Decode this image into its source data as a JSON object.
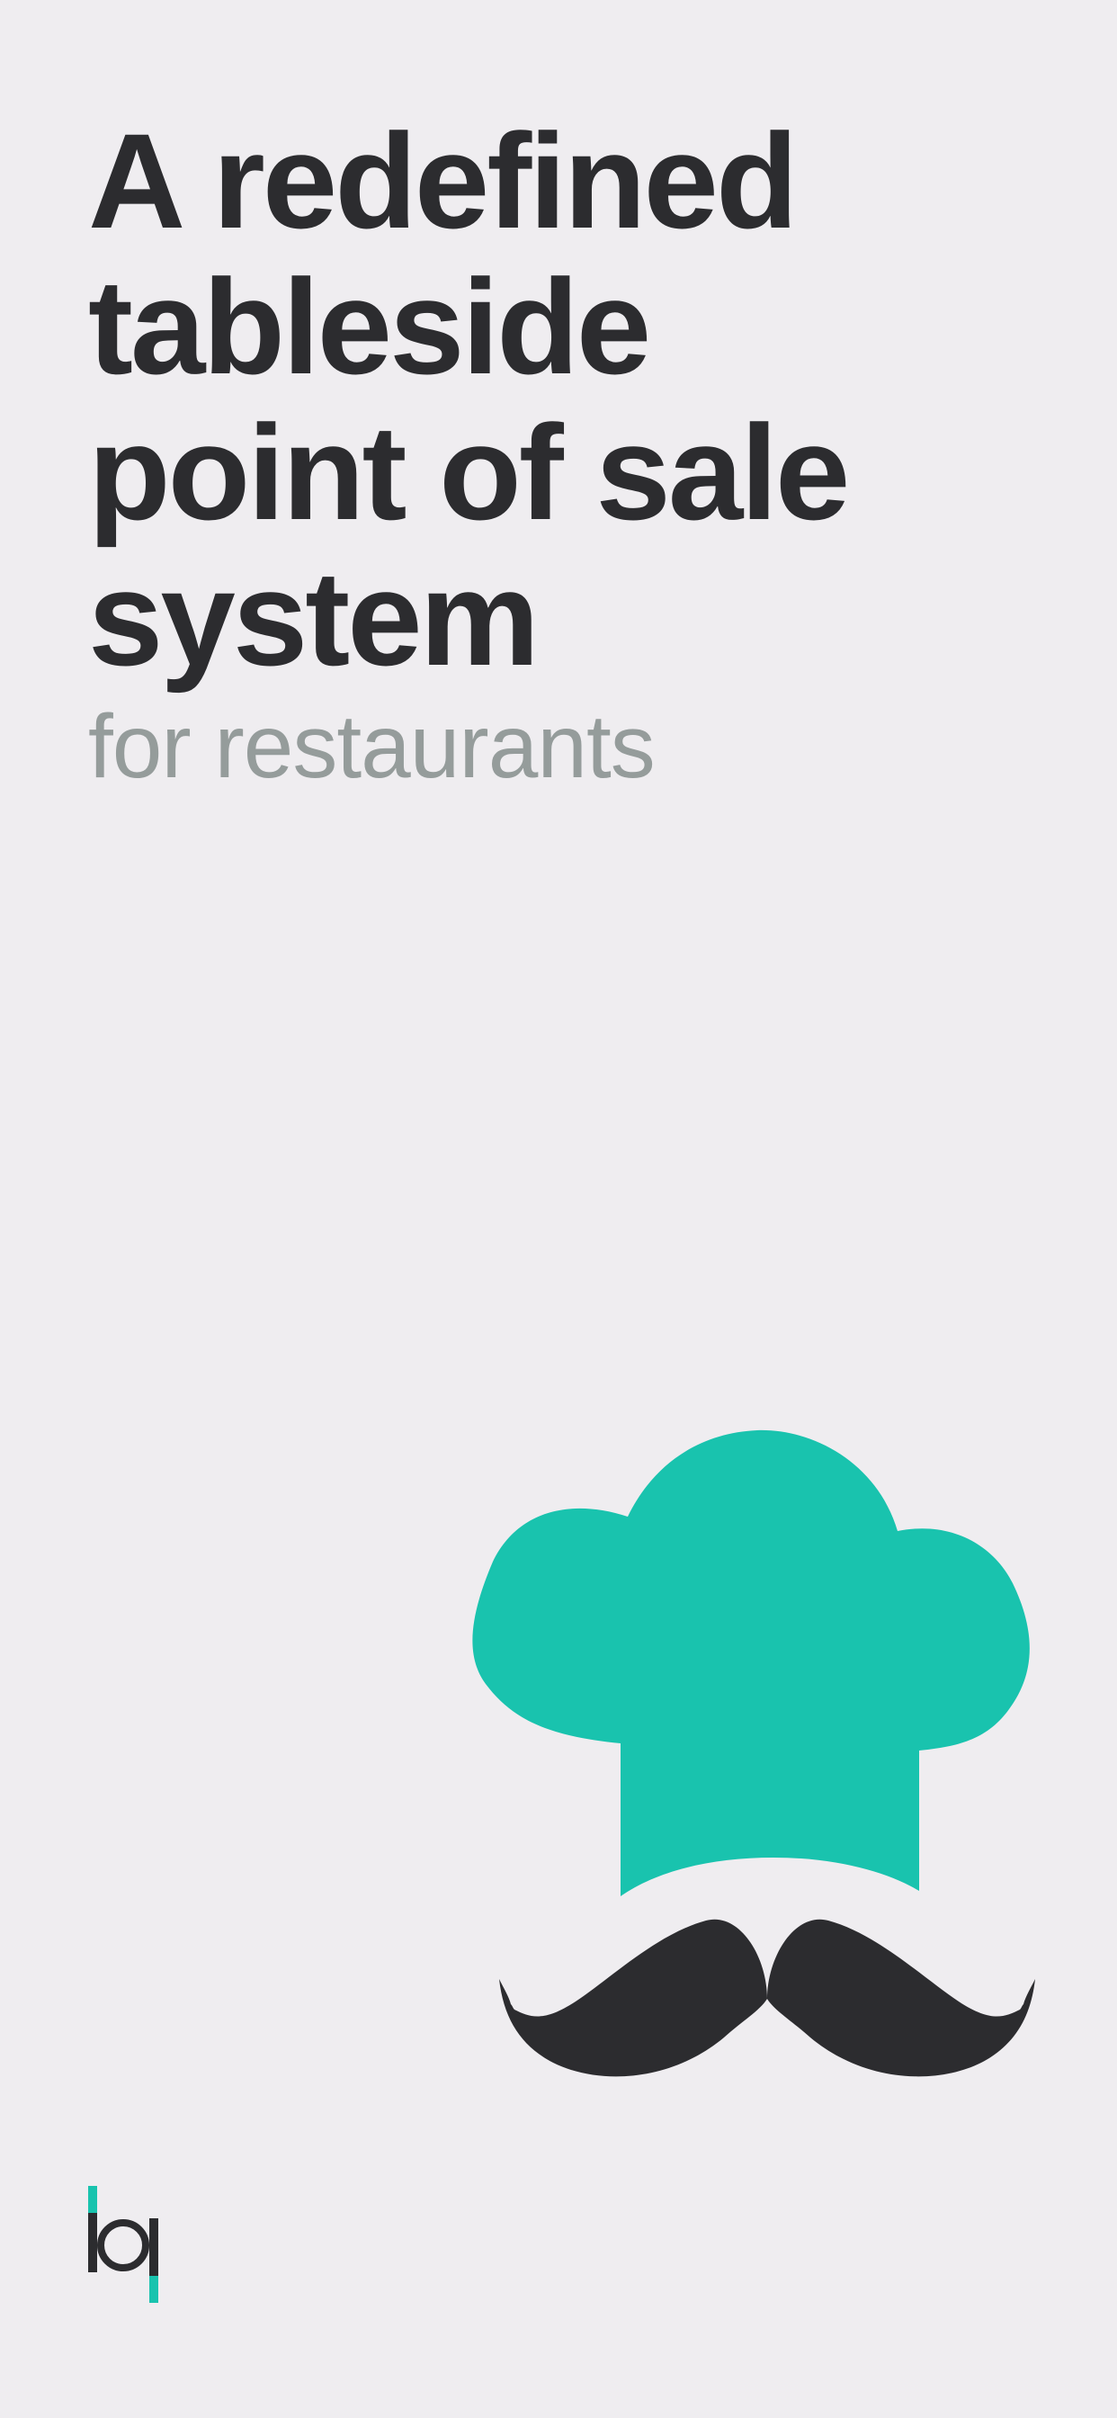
{
  "headline": {
    "lines": [
      "A redefined",
      "tableside",
      "point of sale",
      "system"
    ]
  },
  "subheadline": "for restaurants",
  "illustration": {
    "hat_icon": "chef-hat-icon",
    "mustache_icon": "mustache-icon",
    "hat_color": "#19c3ae",
    "mustache_color": "#2c2c2f"
  },
  "logo": {
    "icon": "bq-logo-icon",
    "letters": "bq",
    "dark_color": "#2c2c2f",
    "accent_color": "#19c3ae"
  },
  "colors": {
    "background": "#efedf0",
    "heading": "#2c2c2f",
    "subheading": "#959c9b",
    "accent": "#19c3ae"
  }
}
